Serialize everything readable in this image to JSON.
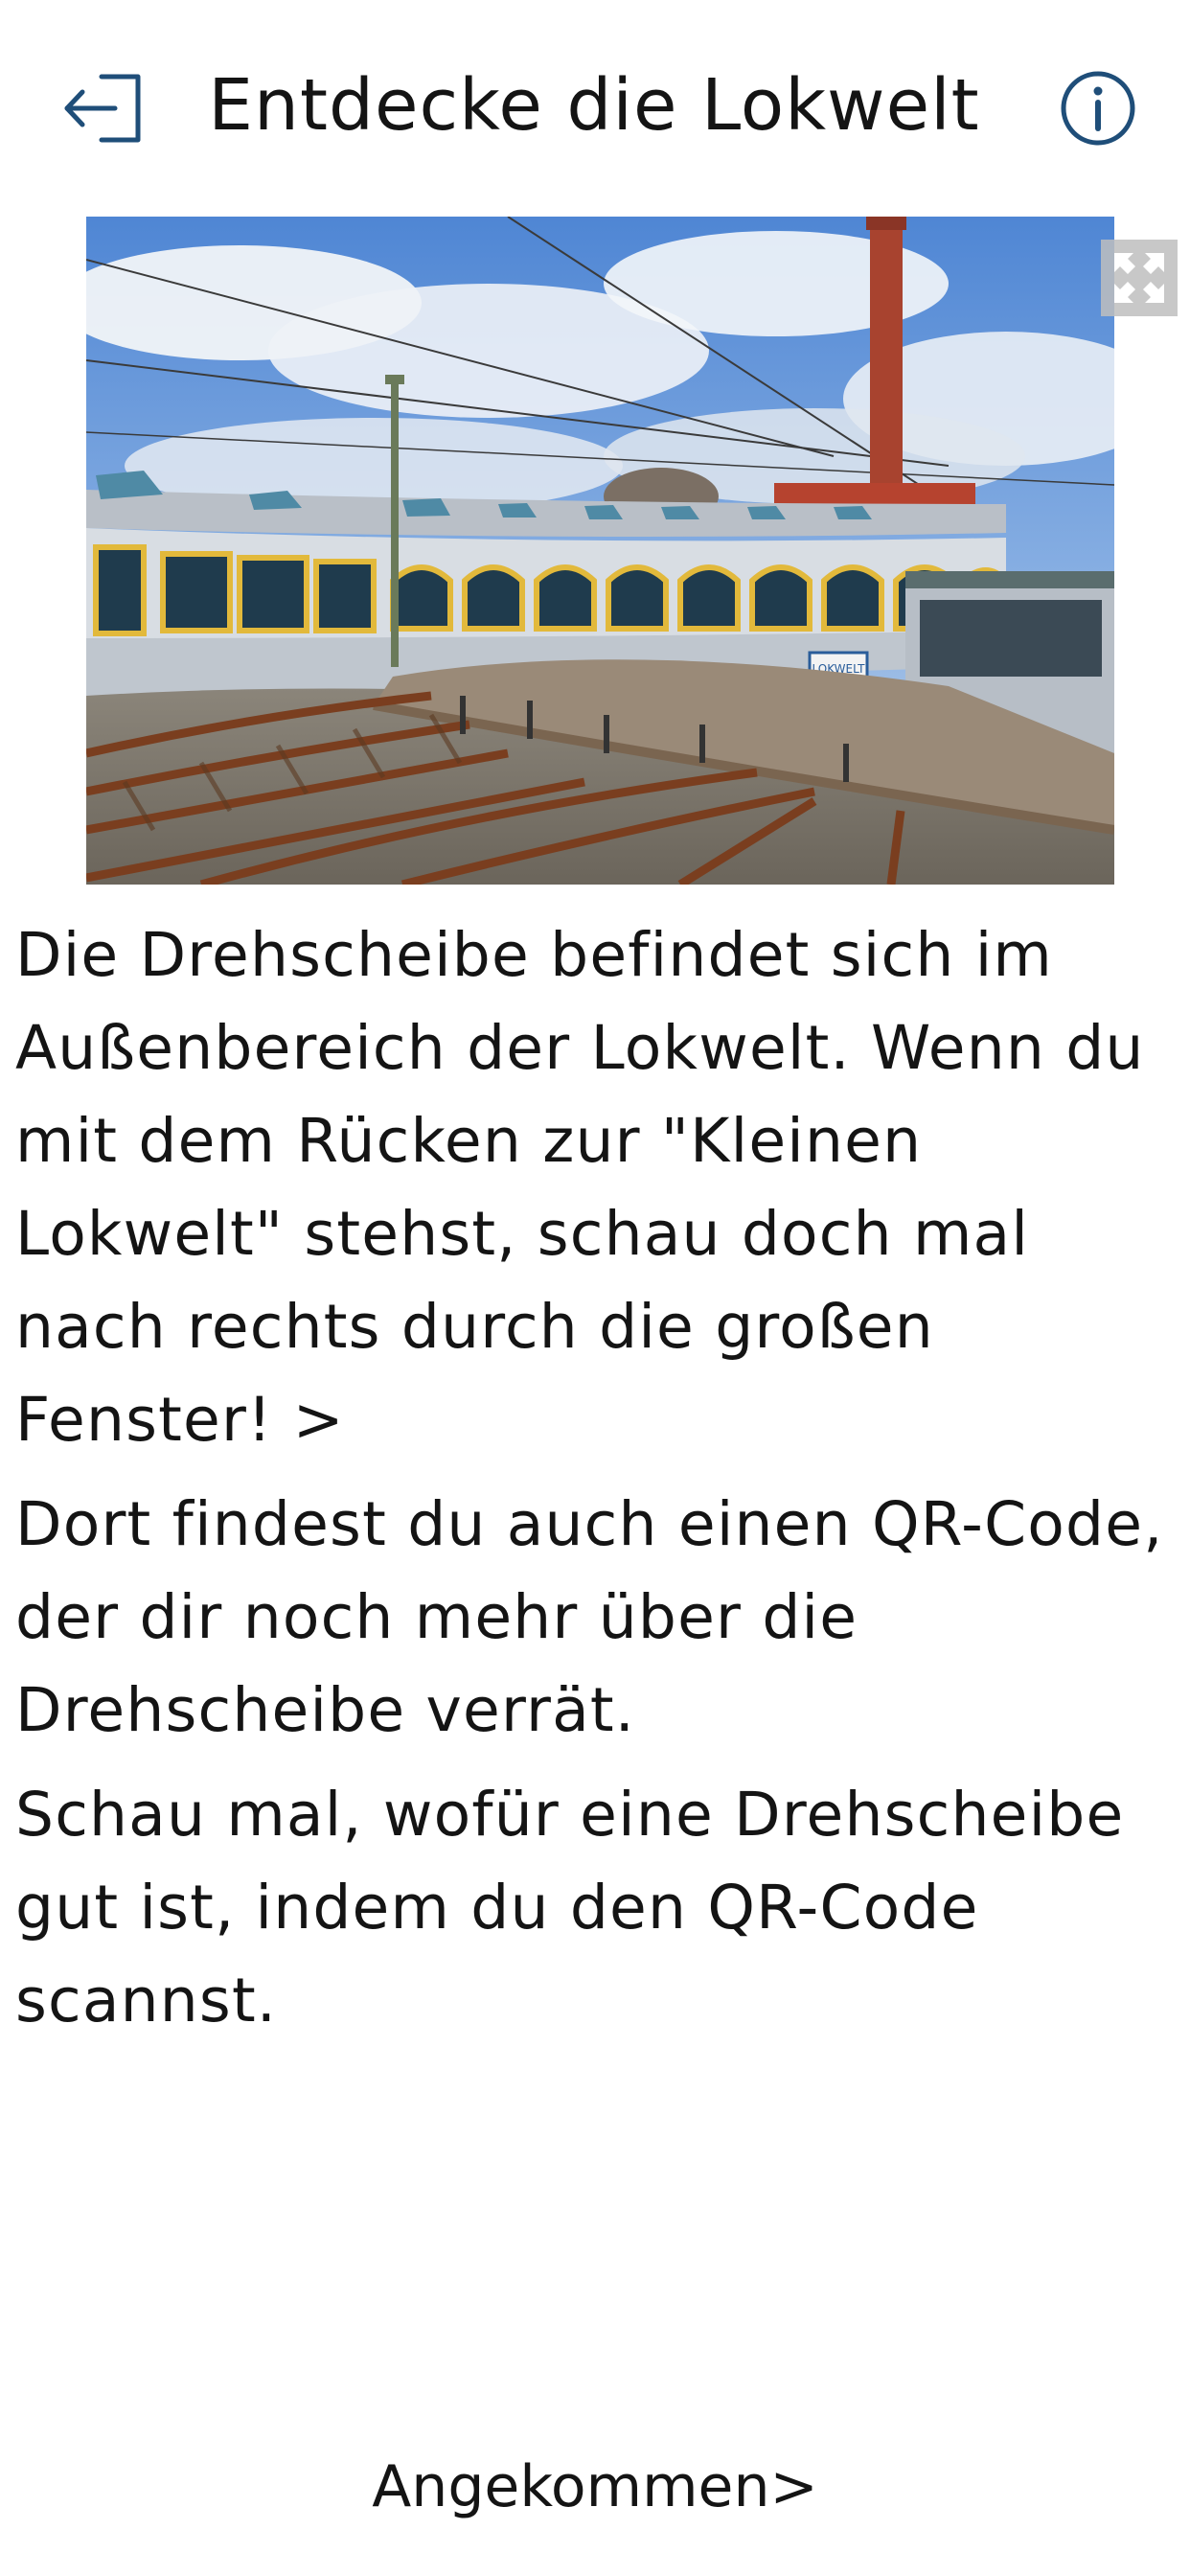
{
  "header": {
    "title": "Entdecke die Lokwelt",
    "exit_icon": "exit-icon",
    "info_icon": "info-icon",
    "accent_color": "#1f4e79"
  },
  "hero_image": {
    "icon": "fullscreen-icon",
    "sign_text": "LOKWELT"
  },
  "content": {
    "paragraphs": [
      "Die Drehscheibe befindet sich im Außenbereich der Lokwelt. Wenn du mit dem Rücken zur \"Kleinen Lokwelt\" stehst, schau doch mal nach rechts durch die großen Fenster! >",
      "Dort findest du auch einen QR-Code, der dir noch mehr über die Drehscheibe verrät.",
      "Schau mal, wofür eine Drehscheibe gut ist, indem du den QR-Code scannst."
    ]
  },
  "footer": {
    "arrived_label": "Angekommen>"
  }
}
